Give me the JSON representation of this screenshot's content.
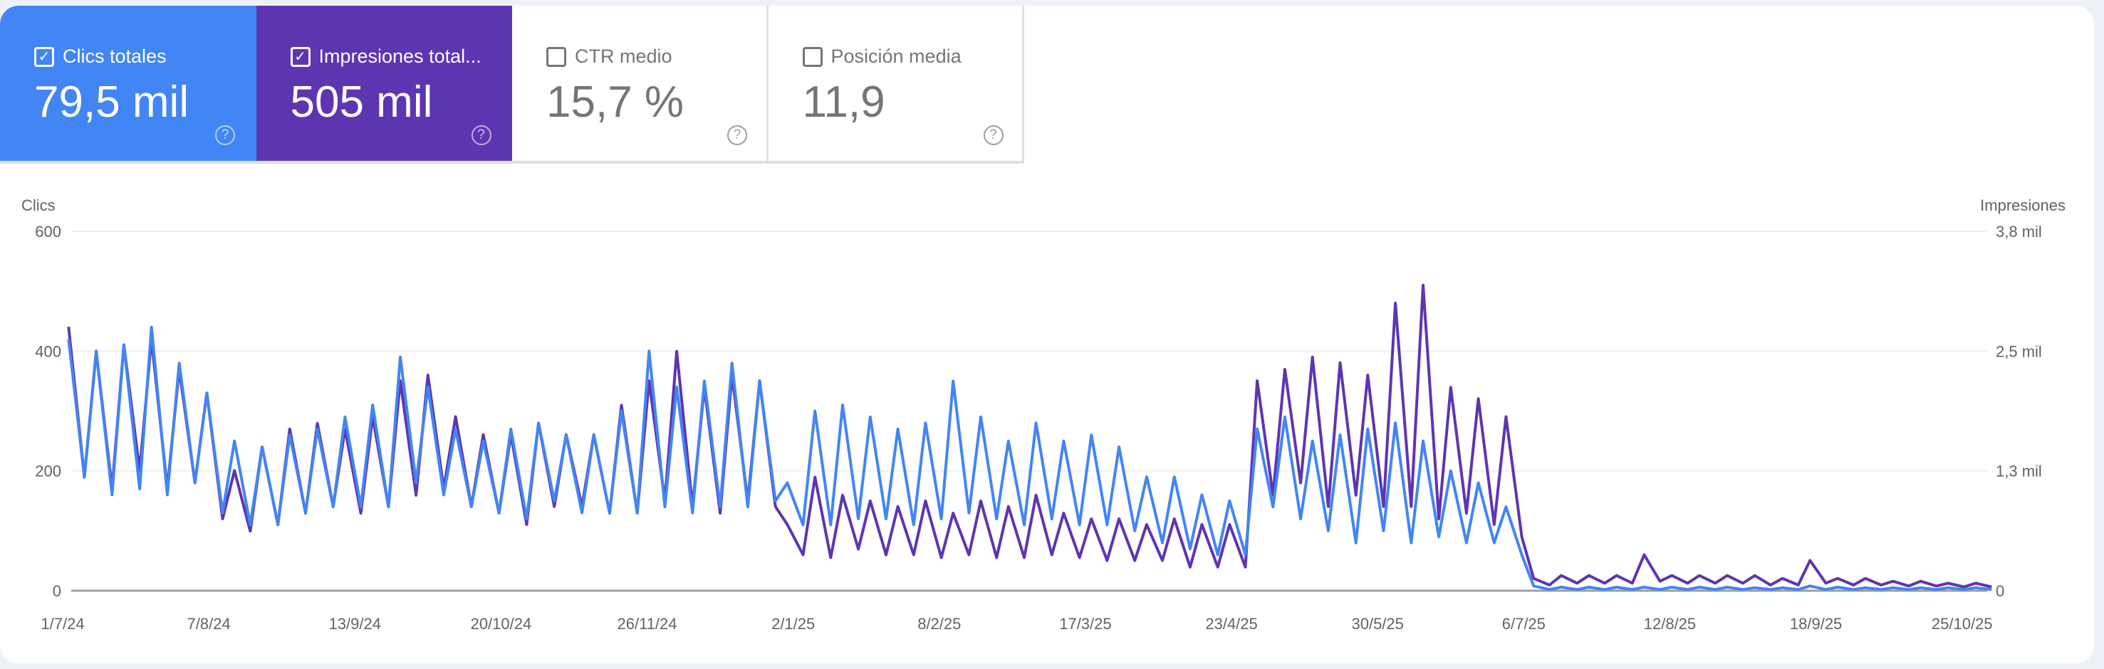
{
  "cards": [
    {
      "label": "Clics totales",
      "value": "79,5 mil",
      "checked": true,
      "color": "#4285f4"
    },
    {
      "label": "Impresiones total...",
      "value": "505 mil",
      "checked": true,
      "color": "#5e35b1"
    },
    {
      "label": "CTR medio",
      "value": "15,7 %",
      "checked": false
    },
    {
      "label": "Posición media",
      "value": "11,9",
      "checked": false
    }
  ],
  "help_icon": "question-circle-icon",
  "chart_data": {
    "type": "line",
    "ylabel_left": "Clics",
    "ylabel_right": "Impresiones",
    "yticks_left": [
      "0",
      "200",
      "400",
      "600"
    ],
    "yticks_right": [
      "0",
      "1,3 mil",
      "2,5 mil",
      "3,8 mil"
    ],
    "ylim_left": [
      0,
      600
    ],
    "ylim_right": [
      0,
      3800
    ],
    "xticks": [
      "1/7/24",
      "7/8/24",
      "13/9/24",
      "20/10/24",
      "26/11/24",
      "2/1/25",
      "8/2/25",
      "17/3/25",
      "23/4/25",
      "30/5/25",
      "6/7/25",
      "12/8/25",
      "18/9/25",
      "25/10/25"
    ],
    "xlim": [
      "1/7/24",
      "31/10/25"
    ],
    "grid": true,
    "weeks": [
      "1/7/24",
      "8/7/24",
      "15/7/24",
      "22/7/24",
      "29/7/24",
      "5/8/24",
      "12/8/24",
      "19/8/24",
      "26/8/24",
      "2/9/24",
      "9/9/24",
      "16/9/24",
      "23/9/24",
      "30/9/24",
      "7/10/24",
      "14/10/24",
      "21/10/24",
      "28/10/24",
      "4/11/24",
      "11/11/24",
      "18/11/24",
      "25/11/24",
      "2/12/24",
      "9/12/24",
      "16/12/24",
      "23/12/24",
      "30/12/24",
      "6/1/25",
      "13/1/25",
      "20/1/25",
      "27/1/25",
      "3/2/25",
      "10/2/25",
      "17/2/25",
      "24/2/25",
      "3/3/25",
      "10/3/25",
      "17/3/25",
      "24/3/25",
      "31/3/25",
      "7/4/25",
      "14/4/25",
      "21/4/25",
      "28/4/25",
      "5/5/25",
      "12/5/25",
      "19/5/25",
      "26/5/25",
      "2/6/25",
      "9/6/25",
      "16/6/25",
      "23/6/25",
      "30/6/25",
      "7/7/25",
      "14/7/25",
      "21/7/25",
      "28/7/25",
      "4/8/25",
      "11/8/25",
      "18/8/25",
      "25/8/25",
      "1/9/25",
      "8/9/25",
      "15/9/25",
      "22/9/25",
      "29/9/25",
      "6/10/25",
      "13/10/25",
      "20/10/25",
      "27/10/25"
    ],
    "series": [
      {
        "key": "clicks",
        "axis": "left",
        "color": "#4285f4",
        "weekday_high": [
          420,
          400,
          410,
          440,
          380,
          330,
          250,
          240,
          260,
          270,
          290,
          310,
          390,
          340,
          270,
          250,
          270,
          280,
          260,
          260,
          300,
          400,
          340,
          350,
          380,
          350,
          180,
          300,
          310,
          290,
          270,
          280,
          350,
          290,
          250,
          280,
          250,
          260,
          240,
          190,
          190,
          160,
          150,
          270,
          290,
          250,
          260,
          270,
          280,
          250,
          200,
          180,
          140,
          8,
          6,
          6,
          6,
          6,
          6,
          6,
          6,
          5,
          5,
          8,
          6,
          5,
          5,
          5,
          5,
          5
        ],
        "weekend_low": [
          190,
          160,
          170,
          160,
          180,
          130,
          110,
          110,
          130,
          140,
          140,
          140,
          180,
          160,
          140,
          130,
          120,
          150,
          130,
          130,
          130,
          140,
          130,
          140,
          140,
          150,
          110,
          110,
          120,
          120,
          110,
          120,
          130,
          120,
          110,
          120,
          110,
          110,
          100,
          80,
          70,
          60,
          60,
          140,
          120,
          100,
          80,
          100,
          80,
          90,
          80,
          80,
          60,
          2,
          2,
          2,
          2,
          2,
          2,
          2,
          2,
          2,
          2,
          2,
          2,
          2,
          2,
          2,
          2,
          2
        ]
      },
      {
        "key": "impressions",
        "axis": "right",
        "color": "#5e35b1",
        "weekday_high": [
          2790,
          2530,
          2600,
          2660,
          2340,
          2090,
          1270,
          1520,
          1710,
          1770,
          1710,
          1840,
          2220,
          2280,
          1840,
          1650,
          1650,
          1770,
          1650,
          1650,
          1960,
          2220,
          2530,
          2150,
          2280,
          2220,
          700,
          1200,
          1010,
          950,
          890,
          950,
          820,
          950,
          890,
          1010,
          820,
          760,
          760,
          700,
          760,
          700,
          700,
          2220,
          2340,
          2470,
          2410,
          2280,
          3040,
          3230,
          2150,
          2030,
          1840,
          130,
          160,
          160,
          160,
          380,
          160,
          160,
          160,
          160,
          130,
          320,
          130,
          130,
          100,
          100,
          80,
          80
        ],
        "weekend_low": [
          1200,
          1080,
          1270,
          1080,
          1140,
          760,
          630,
          700,
          820,
          890,
          820,
          890,
          1010,
          1080,
          890,
          820,
          700,
          890,
          890,
          820,
          820,
          950,
          890,
          820,
          950,
          890,
          380,
          350,
          440,
          380,
          380,
          350,
          380,
          350,
          350,
          380,
          350,
          320,
          320,
          320,
          250,
          250,
          250,
          1010,
          1140,
          890,
          1010,
          890,
          890,
          760,
          820,
          700,
          570,
          60,
          80,
          80,
          80,
          100,
          80,
          80,
          80,
          60,
          60,
          80,
          60,
          60,
          50,
          50,
          40,
          40
        ]
      }
    ]
  }
}
